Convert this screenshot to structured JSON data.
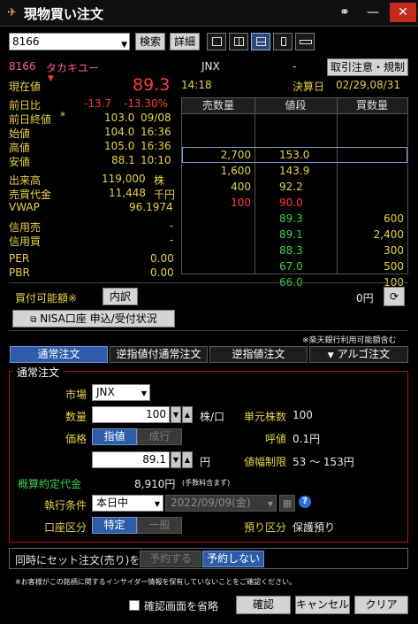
{
  "window": {
    "title": "現物買い注文"
  },
  "toolbar": {
    "symbol_value": "8166",
    "search_label": "検索",
    "detail_label": "詳細"
  },
  "stock": {
    "code": "8166",
    "name": "タカキユー",
    "market": "JNX",
    "dash": "-",
    "rules_button": "取引注意・規制",
    "current_label": "現在値",
    "current_price": "89.3",
    "current_time": "14:18",
    "settlement_label": "決算日",
    "settlement_dates": "02/29,08/31"
  },
  "quote": {
    "prev_change_label": "前日比",
    "prev_change": "-13.7",
    "prev_change_pct": "-13.30%",
    "prev_close_label": "前日終値",
    "prev_close_mark": "*",
    "prev_close": "103.0",
    "prev_close_date": "09/08",
    "open_label": "始値",
    "open": "104.0",
    "open_time": "16:36",
    "high_label": "高値",
    "high": "105.0",
    "high_time": "16:36",
    "low_label": "安値",
    "low": "88.1",
    "low_time": "10:10",
    "volume_label": "出来高",
    "volume": "119,000",
    "volume_unit": "株",
    "turnover_label": "売買代金",
    "turnover": "11,448",
    "turnover_unit": "千円",
    "vwap_label": "VWAP",
    "vwap": "96.1974",
    "margin_sell_label": "信用売",
    "margin_sell": "-",
    "margin_buy_label": "信用買",
    "margin_buy": "-",
    "per_label": "PER",
    "per": "0.00",
    "pbr_label": "PBR",
    "pbr": "0.00"
  },
  "board": {
    "headers": [
      "売数量",
      "値段",
      "買数量"
    ],
    "rows": [
      {
        "sell": "",
        "price": "",
        "buy": ""
      },
      {
        "sell": "",
        "price": "",
        "buy": ""
      },
      {
        "sell": "2,700",
        "price": "153.0",
        "buy": ""
      },
      {
        "sell": "1,600",
        "price": "143.9",
        "buy": ""
      },
      {
        "sell": "400",
        "price": "92.2",
        "buy": ""
      },
      {
        "sell": "100",
        "price": "90.0",
        "buy": ""
      },
      {
        "sell": "",
        "price": "89.3",
        "buy": "600"
      },
      {
        "sell": "",
        "price": "89.1",
        "buy": "2,400"
      },
      {
        "sell": "",
        "price": "88.3",
        "buy": "300"
      },
      {
        "sell": "",
        "price": "67.0",
        "buy": "500"
      },
      {
        "sell": "",
        "price": "66.0",
        "buy": "100"
      }
    ]
  },
  "buying_power": {
    "label": "買付可能額※",
    "detail_button": "内訳",
    "amount": "0円",
    "nisa_button": "NISA口座 申込/受付状況",
    "note": "※楽天銀行利用可能額含む"
  },
  "tabs": [
    {
      "label": "通常注文"
    },
    {
      "label": "逆指値付通常注文"
    },
    {
      "label": "逆指値注文"
    },
    {
      "label": "アルゴ注文"
    }
  ],
  "order": {
    "panel_title": "通常注文",
    "market_label": "市場",
    "market_value": "JNX",
    "qty_label": "数量",
    "qty_value": "100",
    "qty_unit": "株/口",
    "unit_shares_label": "単元株数",
    "unit_shares": "100",
    "price_label": "価格",
    "limit_button": "指値",
    "market_button": "成行",
    "tick_label": "呼値",
    "tick_value": "0.1円",
    "price_value": "89.1",
    "price_unit": "円",
    "range_label": "値幅制限",
    "range_value": "53 ～ 153円",
    "estimate_label": "概算約定代金",
    "estimate_value": "8,910円",
    "estimate_note": "(手数料含まず)",
    "condition_label": "執行条件",
    "condition_value": "本日中",
    "date_value": "2022/09/09(金)",
    "account_label": "口座区分",
    "account_specific": "特定",
    "account_general": "一般",
    "custody_label": "預り区分",
    "custody_value": "保護預り"
  },
  "set_order": {
    "label": "同時にセット注文(売り)を",
    "reserve_button": "予約する",
    "no_reserve_button": "予約しない"
  },
  "notice": "※お客様がこの銘柄に関するインサイダー情報を保有していないことをご確認ください。",
  "footer": {
    "skip_confirm_label": "確認画面を省略",
    "confirm_button": "確認",
    "cancel_button": "キャンセル",
    "clear_button": "クリア"
  }
}
